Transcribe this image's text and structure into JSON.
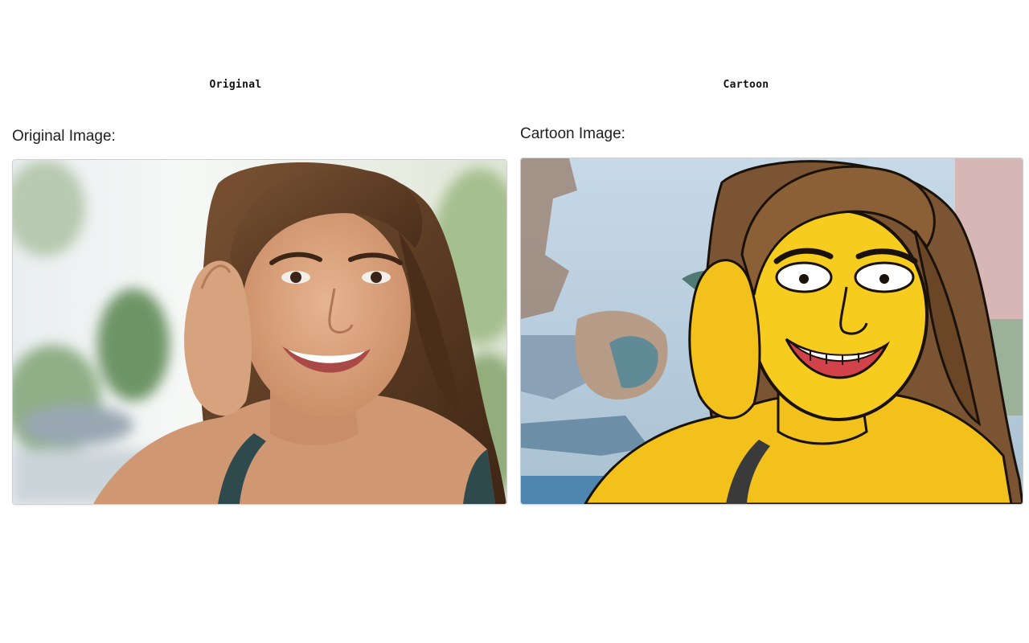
{
  "columns": {
    "original": {
      "heading": "Original",
      "label": "Original Image:"
    },
    "cartoon": {
      "heading": "Cartoon",
      "label": "Cartoon Image:"
    }
  },
  "colors": {
    "skin": "#d9a07a",
    "hair": "#5a3b22",
    "cartoon_skin": "#f6cd1f",
    "cartoon_sky": "#b9cfdf",
    "foliage": "#a9c39a"
  }
}
